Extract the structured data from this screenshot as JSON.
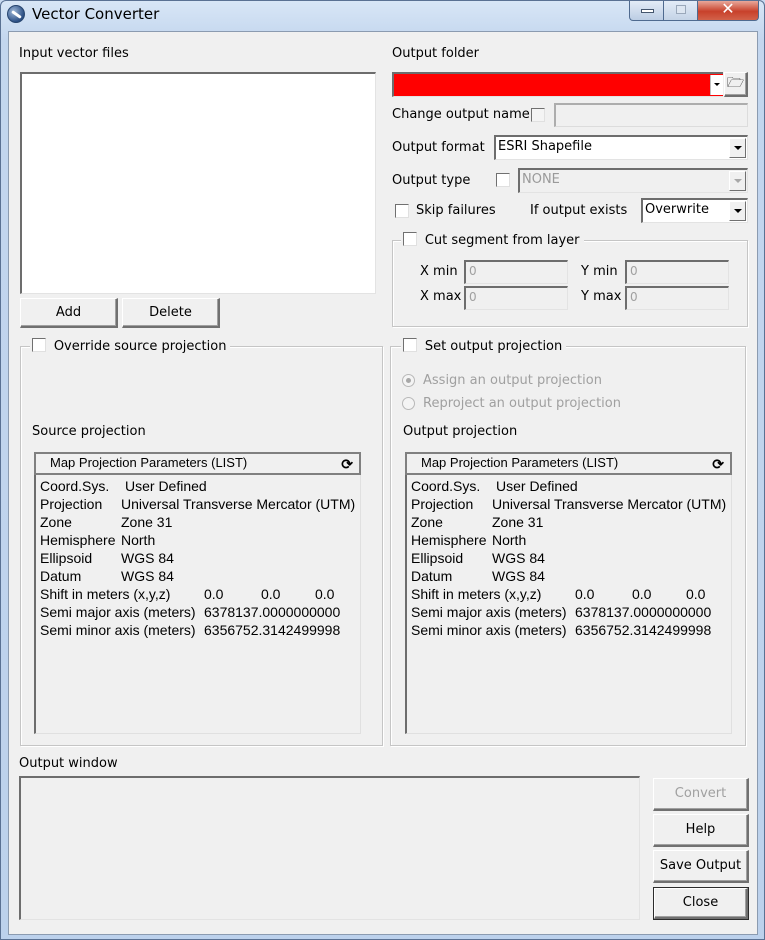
{
  "window": {
    "title": "Vector Converter",
    "caption_buttons": [
      "minimize",
      "maximize",
      "close"
    ]
  },
  "input": {
    "label": "Input vector files",
    "files": [],
    "add_label": "Add",
    "delete_label": "Delete"
  },
  "output": {
    "folder_label": "Output folder",
    "folder_value": "",
    "folder_highlight_color": "#ff0000",
    "change_name_label": "Change output name",
    "change_name_checked": false,
    "change_name_value": "",
    "format_label": "Output format",
    "format_value": "ESRI Shapefile",
    "type_label": "Output type",
    "type_checked": false,
    "type_value": "NONE",
    "skip_failures_label": "Skip failures",
    "skip_failures_checked": false,
    "if_exists_label": "If output exists",
    "if_exists_value": "Overwrite"
  },
  "cut_segment": {
    "label": "Cut segment from layer",
    "checked": false,
    "xmin_label": "X min",
    "xmin_value": "0",
    "ymin_label": "Y min",
    "ymin_value": "0",
    "xmax_label": "X max",
    "xmax_value": "0",
    "ymax_label": "Y max",
    "ymax_value": "0"
  },
  "source_projection": {
    "override_label": "Override source projection",
    "override_checked": false,
    "section_label": "Source projection",
    "list_header": "Map Projection Parameters (LIST)",
    "rows": [
      {
        "key": "Coord.Sys.",
        "value": "User Defined"
      },
      {
        "key": "Projection",
        "value": "Universal Transverse Mercator (UTM)"
      },
      {
        "key": "Zone",
        "value": "Zone 31"
      },
      {
        "key": "Hemisphere",
        "value": "North"
      },
      {
        "key": "Ellipsoid",
        "value": "WGS 84"
      },
      {
        "key": "Datum",
        "value": "WGS 84"
      }
    ],
    "shift_label": "Shift in meters (x,y,z)",
    "shift_values": [
      "0.0",
      "0.0",
      "0.0"
    ],
    "semi_major_label": "Semi major axis (meters)",
    "semi_major_value": "6378137.0000000000",
    "semi_minor_label": "Semi minor axis (meters)",
    "semi_minor_value": "6356752.3142499998"
  },
  "output_projection": {
    "set_label": "Set output projection",
    "set_checked": false,
    "assign_label": "Assign an output projection",
    "reproject_label": "Reproject an output projection",
    "selected_mode": "assign",
    "section_label": "Output projection",
    "list_header": "Map Projection Parameters (LIST)",
    "rows": [
      {
        "key": "Coord.Sys.",
        "value": "User Defined"
      },
      {
        "key": "Projection",
        "value": "Universal Transverse Mercator (UTM)"
      },
      {
        "key": "Zone",
        "value": "Zone 31"
      },
      {
        "key": "Hemisphere",
        "value": "North"
      },
      {
        "key": "Ellipsoid",
        "value": "WGS 84"
      },
      {
        "key": "Datum",
        "value": "WGS 84"
      }
    ],
    "shift_label": "Shift in meters (x,y,z)",
    "shift_values": [
      "0.0",
      "0.0",
      "0.0"
    ],
    "semi_major_label": "Semi major axis (meters)",
    "semi_major_value": "6378137.0000000000",
    "semi_minor_label": "Semi minor axis (meters)",
    "semi_minor_value": "6356752.3142499998"
  },
  "output_window": {
    "label": "Output window",
    "content": ""
  },
  "actions": {
    "convert_label": "Convert",
    "convert_enabled": false,
    "help_label": "Help",
    "save_output_label": "Save Output",
    "close_label": "Close"
  },
  "icons": {
    "app": "vector-converter-logo",
    "browse": "open-folder-icon",
    "refresh": "refresh-icon"
  }
}
